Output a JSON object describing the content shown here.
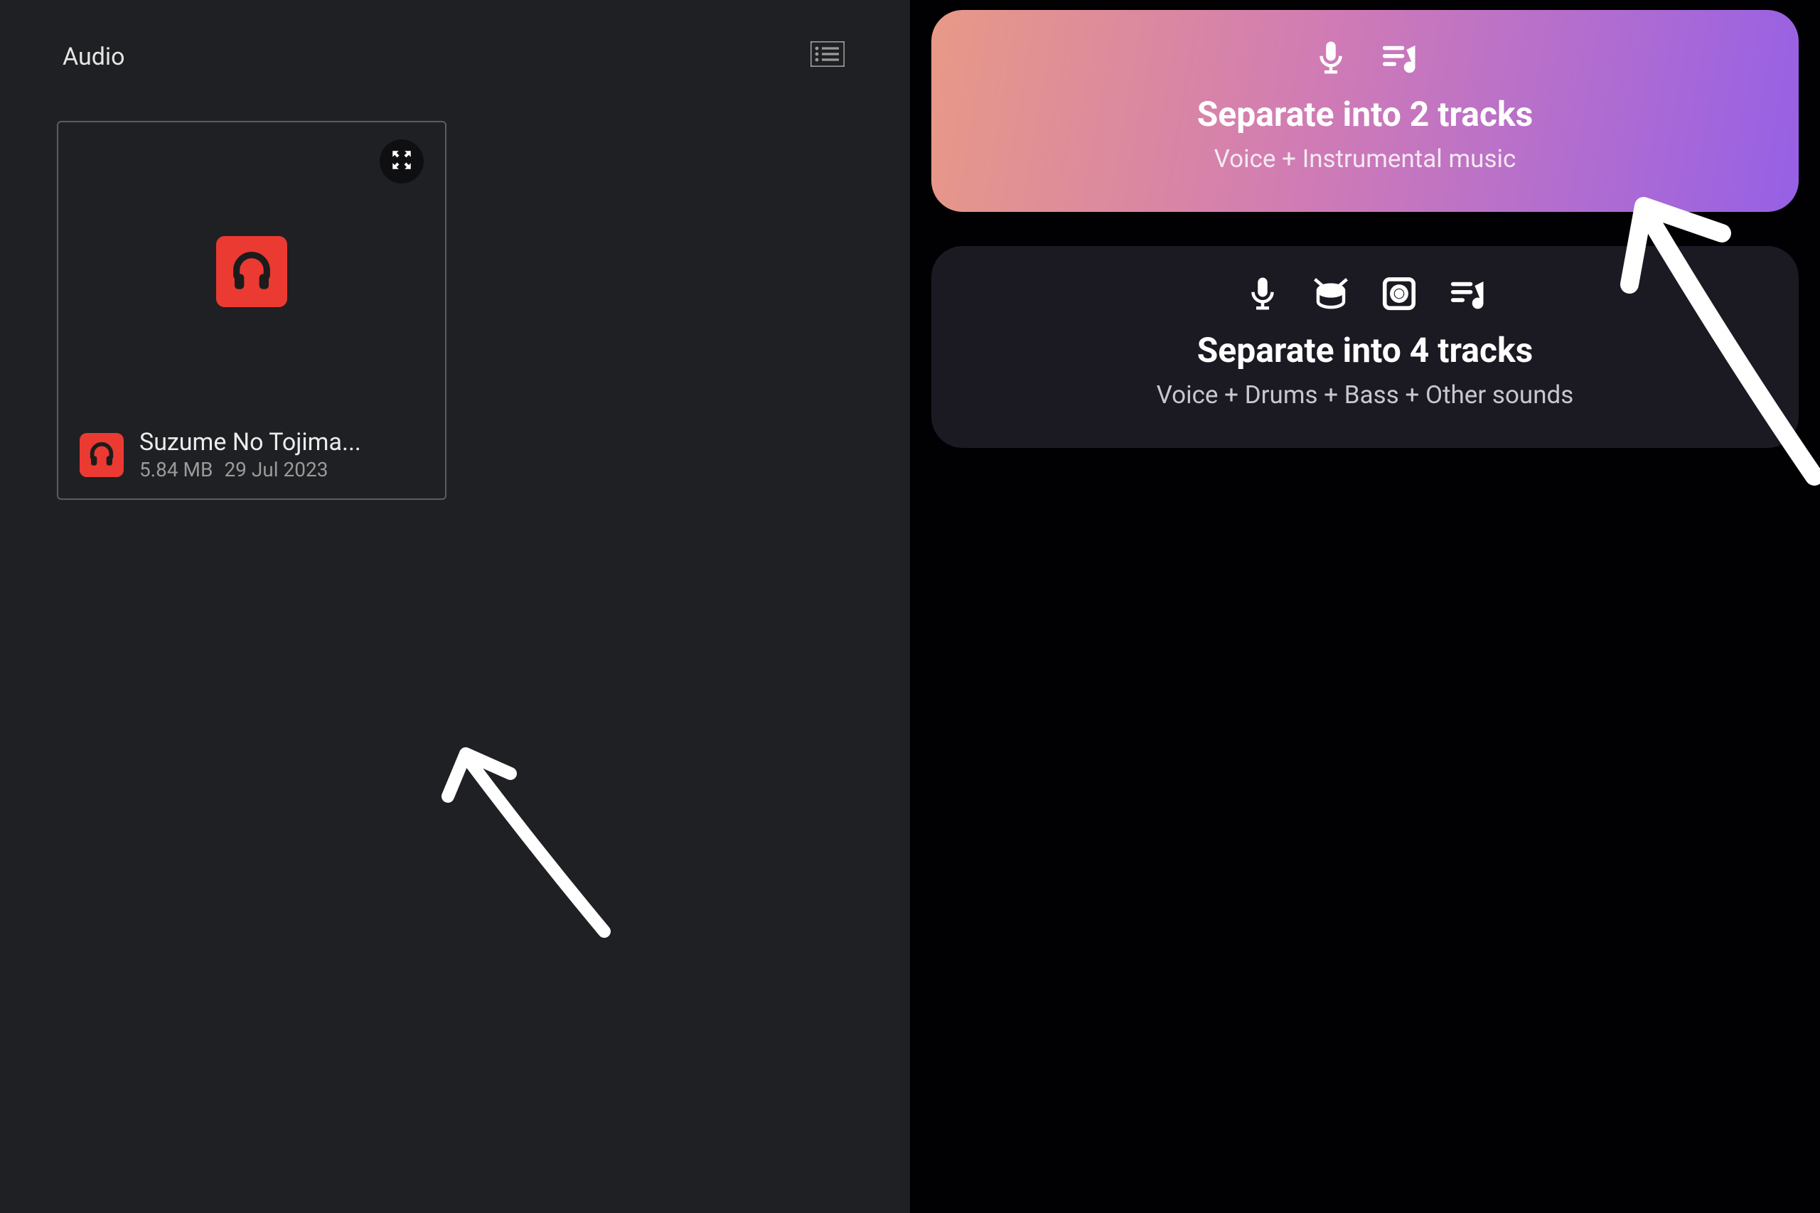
{
  "left": {
    "header_title": "Audio",
    "file": {
      "name": "Suzume No Tojima...",
      "size": "5.84 MB",
      "date": "29 Jul 2023"
    }
  },
  "right": {
    "option2": {
      "title": "Separate into 2 tracks",
      "subtitle": "Voice + Instrumental music"
    },
    "option4": {
      "title": "Separate into 4 tracks",
      "subtitle": "Voice + Drums + Bass + Other sounds"
    }
  },
  "colors": {
    "accent_red": "#eb3a32",
    "gradient_start": "#e89986",
    "gradient_end": "#9660e6"
  }
}
